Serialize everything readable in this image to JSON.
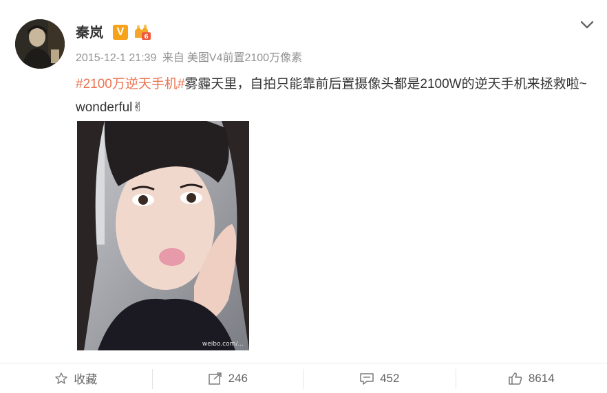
{
  "post": {
    "author": "秦岚",
    "verified_badge": "V",
    "time": "2015-12-1 21:39",
    "source_prefix": "来自",
    "source": "美图V4前置2100万像素",
    "hashtag": "#2100万逆天手机#",
    "body_text": "雾霾天里，自拍只能靠前后置摄像头都是2100W的逆天手机来拯救啦~ wonderful",
    "emoji": "✌",
    "image_watermark": "weibo.com/..."
  },
  "actions": {
    "favorite_label": "收藏",
    "repost_count": "246",
    "comment_count": "452",
    "like_count": "8614"
  },
  "colors": {
    "hashtag": "#eb7350",
    "badge": "#f7a21b",
    "meta": "#939393"
  },
  "icons": [
    "avatar",
    "verified-v-icon",
    "vip-crown-icon",
    "chevron-down-icon",
    "star-icon",
    "repost-icon",
    "comment-icon",
    "like-icon"
  ]
}
